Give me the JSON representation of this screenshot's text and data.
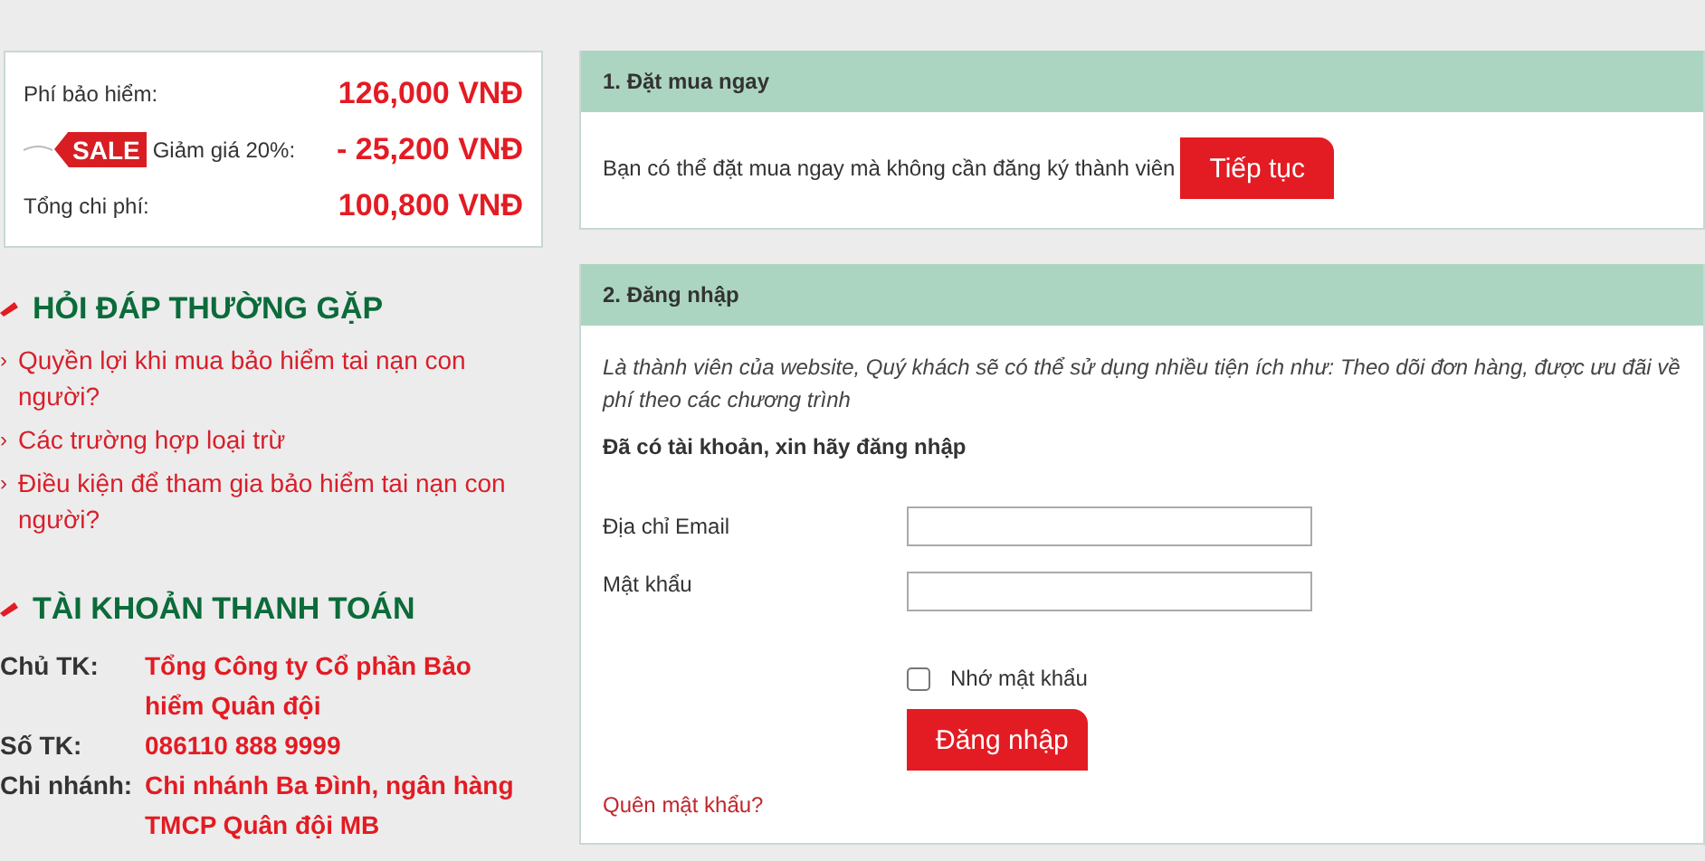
{
  "price_box": {
    "rows": [
      {
        "kind": "plain",
        "label": "Phí bảo hiểm:",
        "value": "126,000 VNĐ"
      },
      {
        "kind": "sale",
        "tag": "SALE",
        "label": "Giảm giá 20%:",
        "value": "- 25,200 VNĐ"
      },
      {
        "kind": "plain",
        "label": "Tổng chi phí:",
        "value": "100,800 VNĐ"
      }
    ]
  },
  "faq": {
    "title": "HỎI ĐÁP THƯỜNG GẶP",
    "items": [
      {
        "marker": "›",
        "text": "Quyền lợi khi mua bảo hiểm tai nạn con người?"
      },
      {
        "marker": "›",
        "text": "Các trường hợp loại trừ"
      },
      {
        "marker": "›",
        "text": "Điều kiện để tham gia bảo hiểm tai nạn con người?"
      }
    ]
  },
  "account": {
    "title": "TÀI KHOẢN THANH TOÁN",
    "rows": [
      {
        "label": "Chủ TK:",
        "value": "Tổng Công ty Cổ phần Bảo hiểm Quân đội"
      },
      {
        "label": "Số TK:",
        "value": "086110 888 9999"
      },
      {
        "label": "Chi nhánh:",
        "value": "Chi nhánh Ba Đình, ngân hàng TMCP Quân đội MB"
      }
    ]
  },
  "buy_now": {
    "title": "1. Đặt mua ngay",
    "text": "Bạn có thể đặt mua ngay mà không cần đăng ký thành viên",
    "button": "Tiếp tục"
  },
  "login": {
    "title": "2. Đăng nhập",
    "intro": "Là thành viên của website, Quý khách sẽ có thể sử dụng nhiều tiện ích như: Theo dõi đơn hàng, được ưu đãi về phí theo các chương trình",
    "prompt": "Đã có tài khoản, xin hãy đăng nhập",
    "fields": [
      {
        "label": "Địa chỉ Email"
      },
      {
        "label": "Mật khẩu"
      }
    ],
    "remember": {
      "label": "Nhớ mật khẩu",
      "checked": false
    },
    "button": "Đăng nhập",
    "forgot": "Quên mật khẩu?"
  }
}
